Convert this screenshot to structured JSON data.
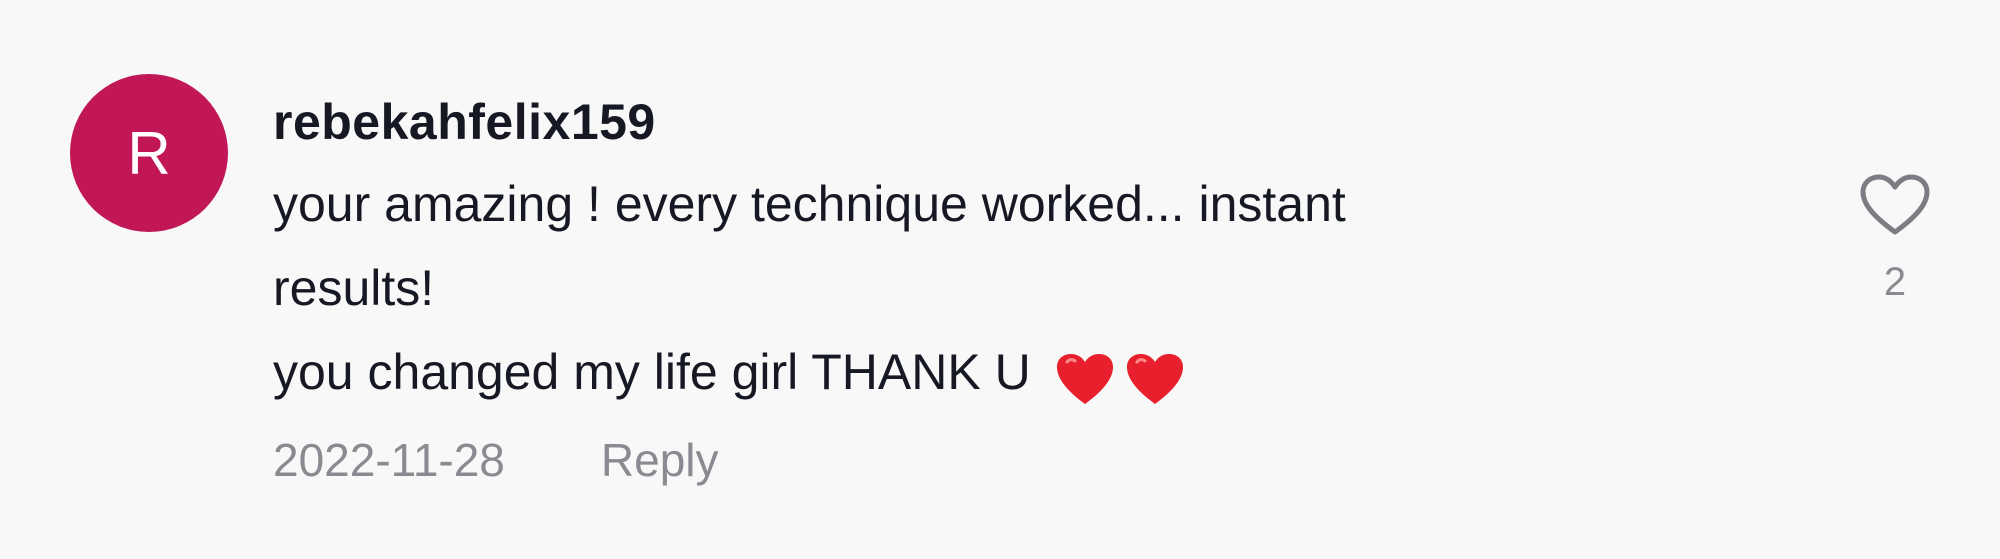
{
  "comment": {
    "avatar_initial": "R",
    "avatar_color": "#c21757",
    "username": "rebekahfelix159",
    "text_lines": [
      "your amazing ! every technique worked... instant",
      "results!",
      "you changed my life girl THANK U"
    ],
    "emoji": [
      "red-heart",
      "red-heart"
    ],
    "date": "2022-11-28",
    "reply_label": "Reply",
    "like_icon": "heart-outline-icon",
    "like_count": "2"
  }
}
